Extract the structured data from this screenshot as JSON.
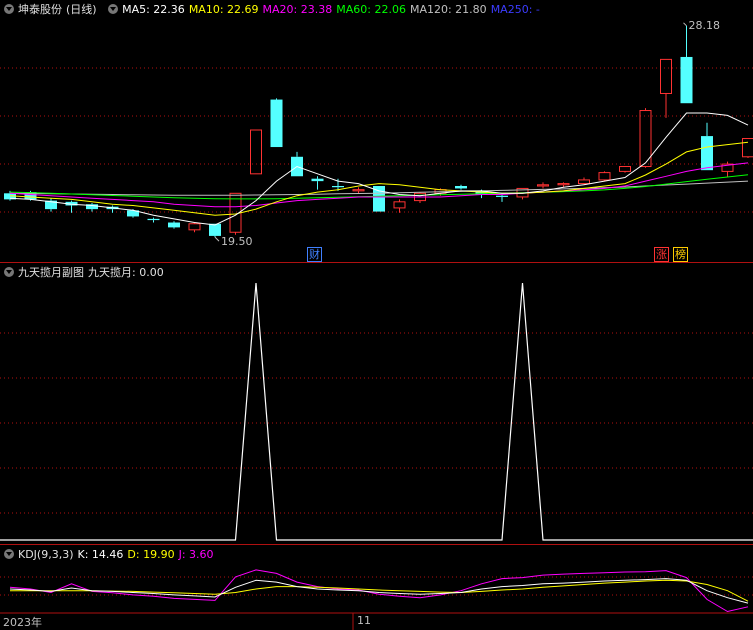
{
  "main_chart": {
    "stock_name": "坤泰股份",
    "period": "(日线)",
    "indicators": [
      {
        "label": "MA5: 22.36",
        "color": "#ffffff"
      },
      {
        "label": "MA10: 22.69",
        "color": "#ffff00"
      },
      {
        "label": "MA20: 23.38",
        "color": "#ff00ff"
      },
      {
        "label": "MA60: 22.06",
        "color": "#00ff00"
      },
      {
        "label": "MA120: 21.80",
        "color": "#c0c0c0"
      },
      {
        "label": "MA250: -",
        "color": "#3c3cff"
      }
    ],
    "high_label": "28.18",
    "low_label": "19.50",
    "badge_finance": "财",
    "badge_limit_up": "涨",
    "badge_rank": "榜"
  },
  "sub_chart": {
    "title": "九天揽月副图",
    "indicator": "九天揽月: 0.00"
  },
  "kdj": {
    "title": "KDJ(9,3,3)",
    "k": "K: 14.46",
    "d": "D: 19.90",
    "j": "J: 3.60"
  },
  "time_axis": [
    "2023年",
    "11"
  ],
  "colors": {
    "up": "#ff3232",
    "down": "#54ffff",
    "grid": "#b01010"
  },
  "chart_data": {
    "type": "candlestick",
    "candles": [
      {
        "o": 21.3,
        "h": 21.4,
        "l": 21.0,
        "c": 21.05
      },
      {
        "o": 21.35,
        "h": 21.4,
        "l": 21.0,
        "c": 21.05
      },
      {
        "o": 21.0,
        "h": 21.1,
        "l": 20.55,
        "c": 20.65
      },
      {
        "o": 20.95,
        "h": 21.0,
        "l": 20.5,
        "c": 20.8
      },
      {
        "o": 20.85,
        "h": 20.9,
        "l": 20.55,
        "c": 20.65
      },
      {
        "o": 20.75,
        "h": 20.8,
        "l": 20.5,
        "c": 20.65
      },
      {
        "o": 20.6,
        "h": 20.65,
        "l": 20.3,
        "c": 20.35
      },
      {
        "o": 20.25,
        "h": 20.3,
        "l": 20.1,
        "c": 20.2
      },
      {
        "o": 20.1,
        "h": 20.15,
        "l": 19.85,
        "c": 19.9
      },
      {
        "o": 19.8,
        "h": 20.1,
        "l": 19.7,
        "c": 20.05
      },
      {
        "o": 20.05,
        "h": 20.05,
        "l": 19.5,
        "c": 19.55
      },
      {
        "o": 19.7,
        "h": 21.3,
        "l": 19.6,
        "c": 21.3
      },
      {
        "o": 22.1,
        "h": 23.9,
        "l": 22.1,
        "c": 23.9
      },
      {
        "o": 25.15,
        "h": 25.2,
        "l": 23.2,
        "c": 23.2
      },
      {
        "o": 22.8,
        "h": 23.0,
        "l": 22.0,
        "c": 22.0
      },
      {
        "o": 21.9,
        "h": 22.0,
        "l": 21.45,
        "c": 21.8
      },
      {
        "o": 21.6,
        "h": 21.9,
        "l": 21.4,
        "c": 21.55
      },
      {
        "o": 21.4,
        "h": 21.55,
        "l": 21.3,
        "c": 21.45
      },
      {
        "o": 21.6,
        "h": 21.6,
        "l": 20.55,
        "c": 20.55
      },
      {
        "o": 20.7,
        "h": 21.05,
        "l": 20.5,
        "c": 20.95
      },
      {
        "o": 21.0,
        "h": 21.35,
        "l": 20.9,
        "c": 21.3
      },
      {
        "o": 21.3,
        "h": 21.5,
        "l": 21.2,
        "c": 21.45
      },
      {
        "o": 21.6,
        "h": 21.65,
        "l": 21.45,
        "c": 21.5
      },
      {
        "o": 21.4,
        "h": 21.45,
        "l": 21.1,
        "c": 21.25
      },
      {
        "o": 21.2,
        "h": 21.25,
        "l": 20.95,
        "c": 21.15
      },
      {
        "o": 21.15,
        "h": 21.5,
        "l": 21.05,
        "c": 21.5
      },
      {
        "o": 21.6,
        "h": 21.75,
        "l": 21.5,
        "c": 21.65
      },
      {
        "o": 21.65,
        "h": 21.75,
        "l": 21.55,
        "c": 21.7
      },
      {
        "o": 21.7,
        "h": 21.95,
        "l": 21.65,
        "c": 21.85
      },
      {
        "o": 21.85,
        "h": 22.2,
        "l": 21.8,
        "c": 22.15
      },
      {
        "o": 22.2,
        "h": 22.4,
        "l": 22.15,
        "c": 22.4
      },
      {
        "o": 22.4,
        "h": 24.8,
        "l": 22.35,
        "c": 24.7
      },
      {
        "o": 25.4,
        "h": 26.8,
        "l": 24.4,
        "c": 26.8
      },
      {
        "o": 26.9,
        "h": 28.18,
        "l": 25.0,
        "c": 25.0
      },
      {
        "o": 23.65,
        "h": 24.2,
        "l": 22.25,
        "c": 22.25
      },
      {
        "o": 22.2,
        "h": 22.6,
        "l": 21.95,
        "c": 22.5
      },
      {
        "o": 22.8,
        "h": 23.55,
        "l": 22.75,
        "c": 23.55
      }
    ],
    "ma5": [
      21.1,
      21.05,
      20.95,
      20.85,
      20.8,
      20.7,
      20.6,
      20.4,
      20.25,
      20.1,
      20.0,
      20.4,
      21.0,
      21.8,
      22.4,
      22.1,
      21.8,
      21.7,
      21.4,
      21.25,
      21.2,
      21.3,
      21.4,
      21.4,
      21.3,
      21.3,
      21.4,
      21.55,
      21.65,
      21.8,
      21.95,
      22.55,
      23.6,
      24.6,
      24.6,
      24.5,
      24.1
    ],
    "ma10": [
      21.2,
      21.15,
      21.1,
      21.05,
      20.95,
      20.85,
      20.8,
      20.7,
      20.6,
      20.5,
      20.4,
      20.45,
      20.65,
      20.95,
      21.2,
      21.35,
      21.45,
      21.6,
      21.7,
      21.65,
      21.55,
      21.45,
      21.4,
      21.35,
      21.3,
      21.3,
      21.35,
      21.4,
      21.5,
      21.6,
      21.7,
      22.05,
      22.5,
      23.0,
      23.2,
      23.3,
      23.4
    ],
    "ma20": [
      21.3,
      21.25,
      21.2,
      21.15,
      21.1,
      21.05,
      21.0,
      20.95,
      20.85,
      20.8,
      20.75,
      20.75,
      20.8,
      20.9,
      21.0,
      21.05,
      21.1,
      21.15,
      21.15,
      21.15,
      21.15,
      21.15,
      21.2,
      21.25,
      21.25,
      21.3,
      21.35,
      21.4,
      21.45,
      21.5,
      21.6,
      21.8,
      22.0,
      22.2,
      22.35,
      22.45,
      22.55
    ],
    "ma60": [
      21.35,
      21.33,
      21.3,
      21.27,
      21.24,
      21.21,
      21.18,
      21.15,
      21.12,
      21.1,
      21.08,
      21.07,
      21.07,
      21.08,
      21.1,
      21.12,
      21.14,
      21.16,
      21.18,
      21.2,
      21.22,
      21.24,
      21.26,
      21.28,
      21.3,
      21.32,
      21.34,
      21.37,
      21.4,
      21.44,
      21.5,
      21.58,
      21.68,
      21.78,
      21.88,
      21.97,
      22.06
    ],
    "ma120": [
      21.3,
      21.29,
      21.28,
      21.27,
      21.26,
      21.25,
      21.24,
      21.23,
      21.22,
      21.22,
      21.22,
      21.22,
      21.23,
      21.24,
      21.25,
      21.26,
      21.28,
      21.29,
      21.3,
      21.32,
      21.34,
      21.36,
      21.38,
      21.4,
      21.42,
      21.44,
      21.46,
      21.48,
      21.5,
      21.53,
      21.56,
      21.6,
      21.64,
      21.68,
      21.72,
      21.76,
      21.8
    ],
    "sub_spikes": [
      12,
      25
    ],
    "sub_range": [
      0,
      1
    ],
    "kdj_k": [
      55,
      52,
      48,
      58,
      50,
      48,
      45,
      42,
      38,
      35,
      32,
      60,
      80,
      75,
      62,
      55,
      52,
      50,
      45,
      42,
      40,
      42,
      45,
      55,
      62,
      65,
      70,
      72,
      75,
      78,
      80,
      82,
      85,
      80,
      50,
      30,
      14.46
    ],
    "kdj_d": [
      50,
      50,
      50,
      50,
      50,
      49,
      48,
      46,
      44,
      42,
      40,
      45,
      55,
      62,
      62,
      60,
      58,
      55,
      52,
      50,
      48,
      46,
      45,
      48,
      52,
      55,
      60,
      64,
      68,
      72,
      75,
      78,
      80,
      78,
      68,
      50,
      19.9
    ],
    "kdj_j": [
      60,
      55,
      45,
      70,
      48,
      44,
      38,
      34,
      28,
      25,
      22,
      90,
      110,
      100,
      75,
      62,
      55,
      52,
      40,
      34,
      30,
      38,
      50,
      70,
      85,
      88,
      95,
      98,
      100,
      102,
      104,
      105,
      108,
      88,
      25,
      -10,
      3.6
    ],
    "kdj_range": [
      -20,
      130
    ]
  }
}
